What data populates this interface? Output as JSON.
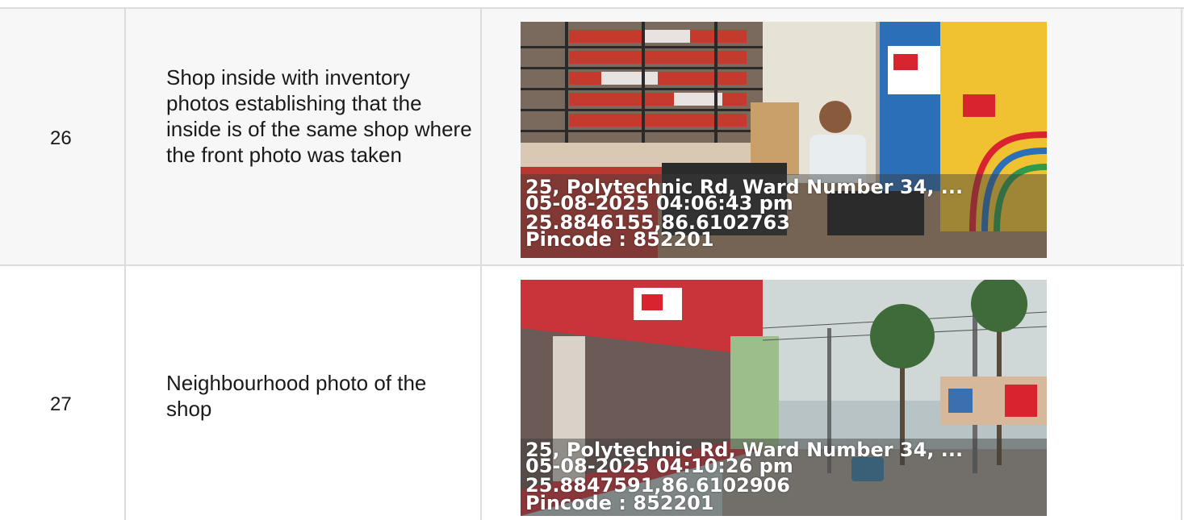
{
  "rows": [
    {
      "number": "26",
      "description": "Shop inside with inventory photos establishing that the inside is of the same shop where the front photo was taken",
      "photo": {
        "subject": "shop interior with shelves of boxed inventory, shopkeeper seated at counter, GM cable boxes on right",
        "overlay": {
          "address": "25, Polytechnic Rd, Ward Number 34, ...",
          "datetime": "05-08-2025 04:06:43 pm",
          "coords": "25.8846155,86.6102763",
          "pincode": "Pincode : 852201"
        }
      }
    },
    {
      "number": "27",
      "description": "Neighbourhood photo of the shop",
      "photo": {
        "subject": "street view of red GM shopfront row with palm trees, utility poles and road",
        "overlay": {
          "address": "25, Polytechnic Rd, Ward Number 34, ...",
          "datetime": "05-08-2025 04:10:26 pm",
          "coords": "25.8847591,86.6102906",
          "pincode": "Pincode : 852201"
        }
      }
    }
  ],
  "colors": {
    "grid": "#dcdcdc",
    "row_shaded": "#f7f7f7",
    "text": "#1a1a1a",
    "brand_red": "#d9232e"
  }
}
